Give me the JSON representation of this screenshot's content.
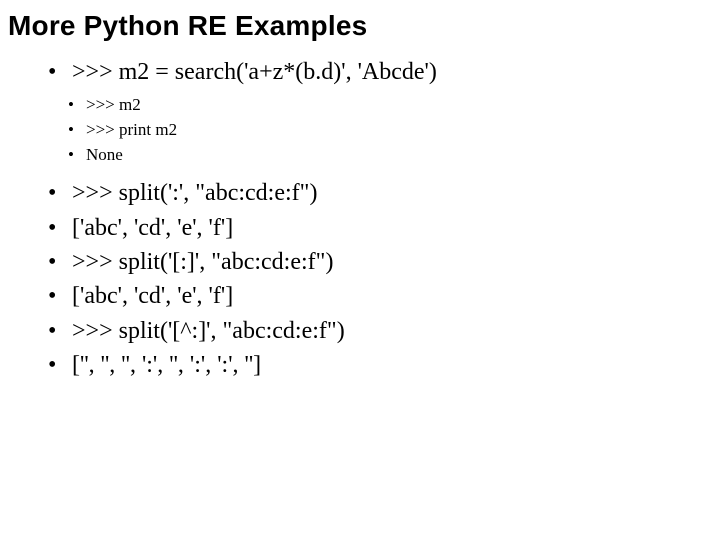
{
  "title": "More Python RE Examples",
  "lvl1_1": ">>> m2 = search('a+z*(b.d)', 'Abcde')",
  "sub": {
    "1": ">>> m2",
    "2": ">>> print m2",
    "3": "None"
  },
  "lvl1_2": ">>> split(':', \"abc:cd:e:f\")",
  "lvl1_3": "['abc', 'cd', 'e', 'f']",
  "lvl1_4": ">>> split('[:]', \"abc:cd:e:f\")",
  "lvl1_5": "['abc', 'cd', 'e', 'f']",
  "lvl1_6": ">>> split('[^:]', \"abc:cd:e:f\")",
  "lvl1_7": "['', '', '', ':', '', ':', ':', '']"
}
